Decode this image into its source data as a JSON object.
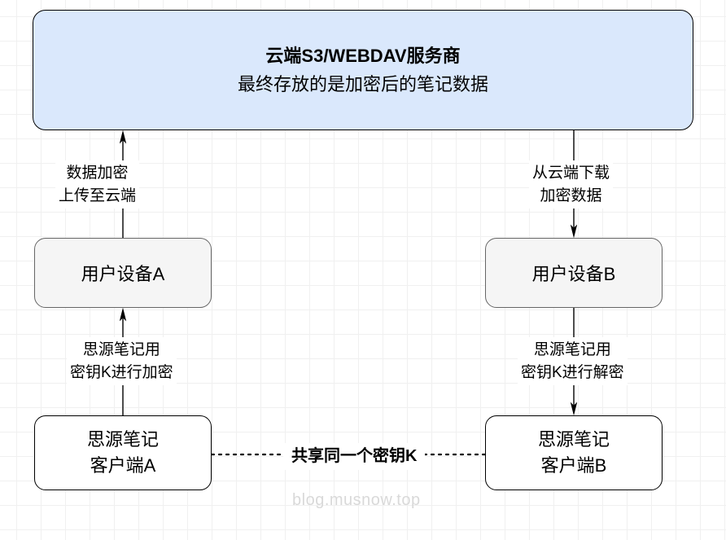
{
  "cloud": {
    "title": "云端S3/WEBDAV服务商",
    "subtitle": "最终存放的是加密后的笔记数据"
  },
  "devices": {
    "a": "用户设备A",
    "b": "用户设备B"
  },
  "clients": {
    "a_line1": "思源笔记",
    "a_line2": "客户端A",
    "b_line1": "思源笔记",
    "b_line2": "客户端B"
  },
  "edges": {
    "upload_line1": "数据加密",
    "upload_line2": "上传至云端",
    "download_line1": "从云端下载",
    "download_line2": "加密数据",
    "encrypt_line1": "思源笔记用",
    "encrypt_line2": "密钥K进行加密",
    "decrypt_line1": "思源笔记用",
    "decrypt_line2": "密钥K进行解密",
    "share_key": "共享同一个密钥K"
  },
  "watermark": "blog.musnow.top"
}
